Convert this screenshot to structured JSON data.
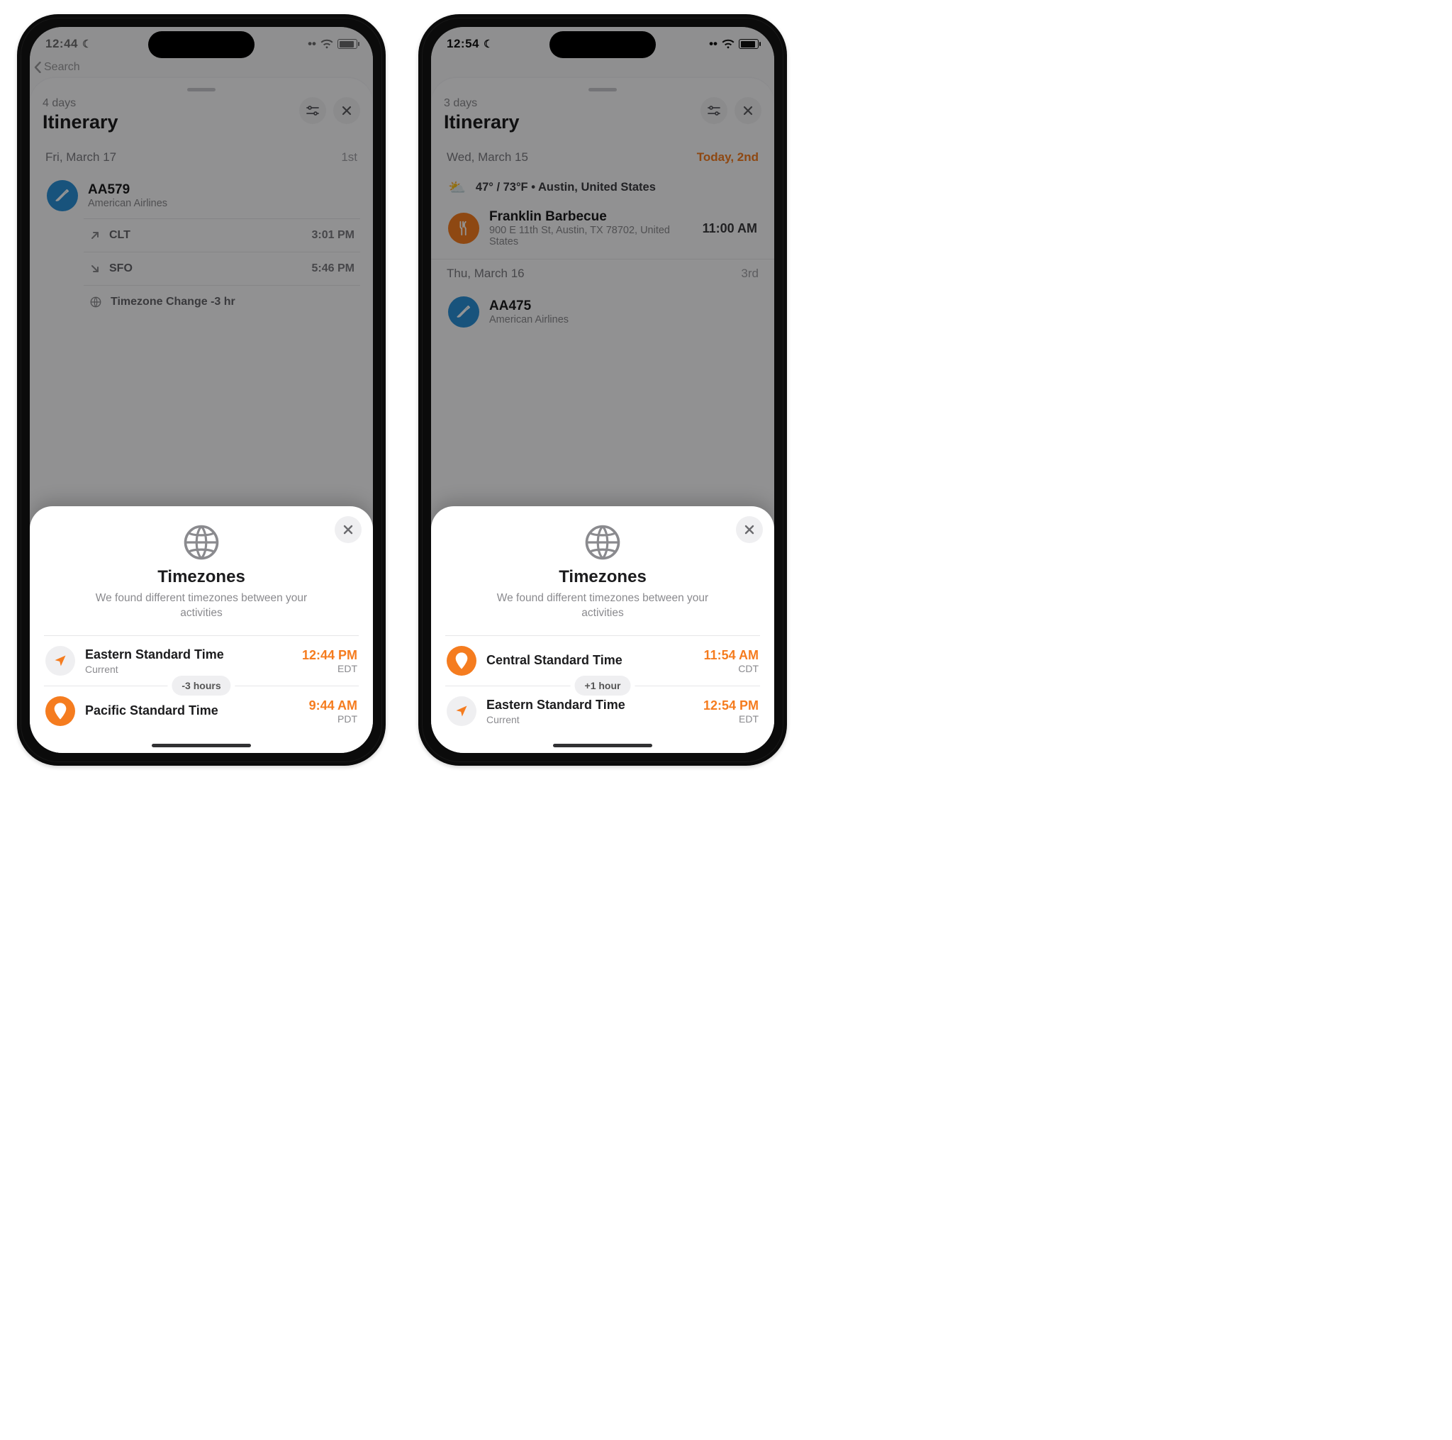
{
  "phones": [
    {
      "status": {
        "time": "12:44",
        "dnd": "☾",
        "signal": "••",
        "wifi": true,
        "batteryPct": 80
      },
      "back_label": "Search",
      "sheet": {
        "days": "4 days",
        "title": "Itinerary",
        "day": {
          "label": "Fri, March 17",
          "right": "1st",
          "today": false
        },
        "flight": {
          "code": "AA579",
          "airline": "American Airlines",
          "legs": [
            {
              "dir": "depart",
              "code": "CLT",
              "time": "3:01 PM"
            },
            {
              "dir": "arrive",
              "code": "SFO",
              "time": "5:46 PM"
            }
          ],
          "tz_change": "Timezone Change -3 hr"
        }
      },
      "modal": {
        "title": "Timezones",
        "subtitle": "We found different timezones between your activities",
        "delta": "-3 hours",
        "items": [
          {
            "icon": "loc",
            "name": "Eastern Standard Time",
            "sub": "Current",
            "time": "12:44 PM",
            "abbr": "EDT"
          },
          {
            "icon": "pin",
            "name": "Pacific Standard Time",
            "sub": "",
            "time": "9:44 AM",
            "abbr": "PDT"
          }
        ]
      }
    },
    {
      "status": {
        "time": "12:54",
        "dnd": "☾",
        "signal": "••",
        "wifi": true,
        "batteryPct": 80
      },
      "back_label": "",
      "sheet": {
        "days": "3 days",
        "title": "Itinerary",
        "day": {
          "label": "Wed, March 15",
          "right": "Today, 2nd",
          "today": true
        },
        "weather": {
          "text": "47° / 73°F • Austin, United States"
        },
        "poi": {
          "name": "Franklin Barbecue",
          "address": "900 E 11th St, Austin, TX  78702, United States",
          "time": "11:00 AM"
        },
        "day2": {
          "label": "Thu, March 16",
          "right": "3rd"
        },
        "flight": {
          "code": "AA475",
          "airline": "American Airlines"
        }
      },
      "modal": {
        "title": "Timezones",
        "subtitle": "We found different timezones between your activities",
        "delta": "+1 hour",
        "items": [
          {
            "icon": "pin",
            "name": "Central Standard Time",
            "sub": "",
            "time": "11:54 AM",
            "abbr": "CDT"
          },
          {
            "icon": "loc",
            "name": "Eastern Standard Time",
            "sub": "Current",
            "time": "12:54 PM",
            "abbr": "EDT"
          }
        ]
      }
    }
  ]
}
